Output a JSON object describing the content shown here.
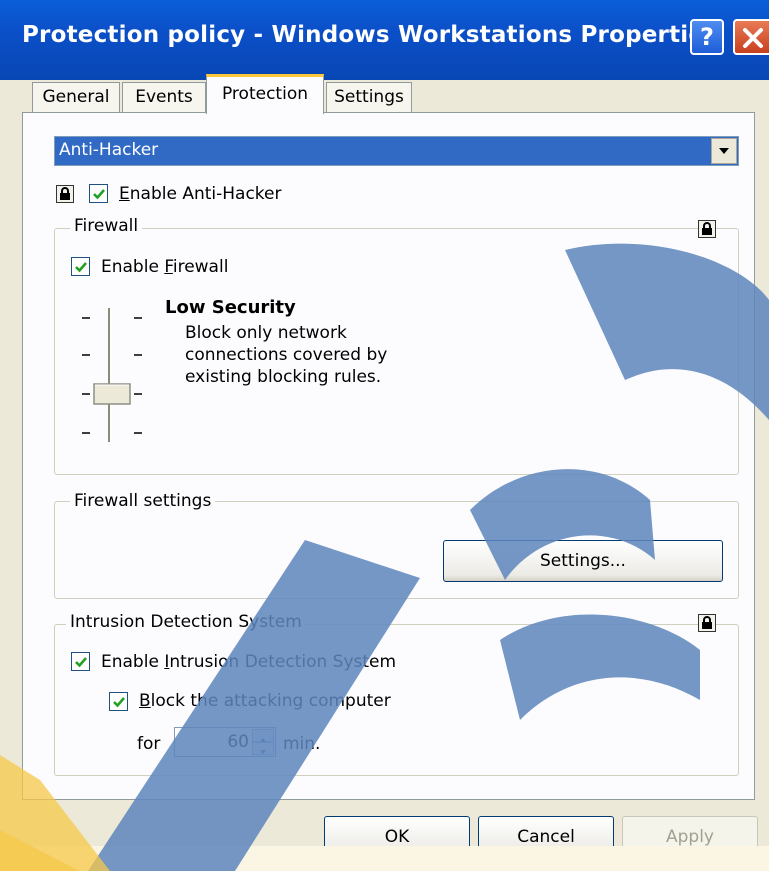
{
  "window": {
    "title": "Protection policy - Windows Workstations Properties"
  },
  "titlebar": {
    "help_glyph": "?"
  },
  "tabs": [
    {
      "label": "General"
    },
    {
      "label": "Events"
    },
    {
      "label": "Protection"
    },
    {
      "label": "Settings"
    }
  ],
  "component_select": {
    "value": "Anti-Hacker"
  },
  "anti_hacker": {
    "checked": true,
    "label_mnemonic": "E",
    "label_rest": "nable Anti-Hacker"
  },
  "firewall": {
    "group_label": "Firewall",
    "enable_checked": true,
    "enable_label_prefix": "Enable ",
    "enable_label_mnemonic": "F",
    "enable_label_rest": "irewall",
    "security_level": {
      "title": "Low Security",
      "description": "Block only network\nconnections covered by\nexisting blocking rules.",
      "ticks": 4,
      "selected_index": 2
    }
  },
  "firewall_settings": {
    "group_label": "Firewall settings",
    "button_label": "Settings..."
  },
  "ids": {
    "group_label": "Intrusion Detection System",
    "enable_checked": true,
    "enable_label_prefix": "Enable ",
    "enable_label_mnemonic": "I",
    "enable_label_rest": "ntrusion Detection System",
    "block_checked": true,
    "block_label_mnemonic": "B",
    "block_label_rest": "lock the attacking computer",
    "for_label": "for",
    "minutes_value": "60",
    "min_label": "min."
  },
  "buttons": {
    "ok": "OK",
    "cancel": "Cancel",
    "apply": "Apply"
  },
  "colors": {
    "titlebar": "#0b4fc8",
    "selection": "#316ac5",
    "watermark_blue": "#5e86bd",
    "watermark_yellow": "#f6c84a"
  }
}
